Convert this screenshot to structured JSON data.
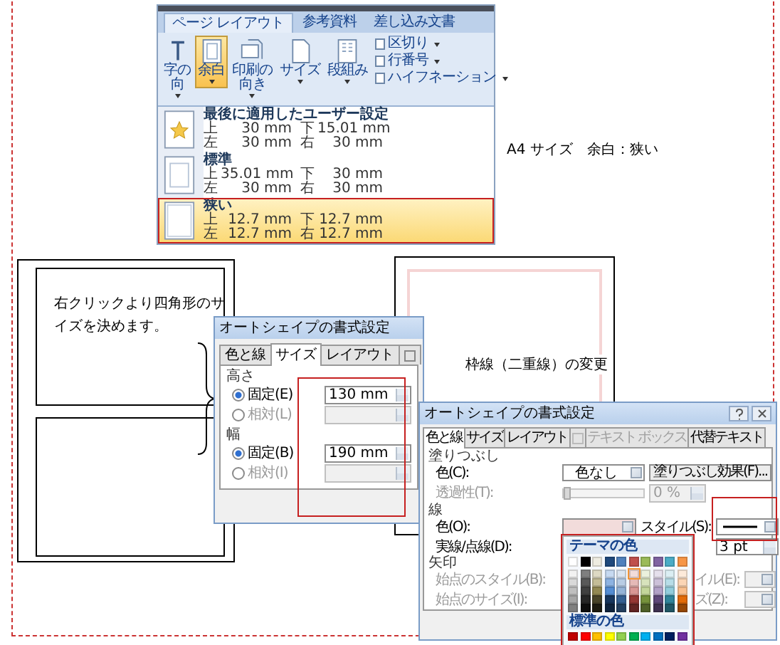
{
  "ribbon": {
    "tabs": [
      {
        "label": "ページ レイアウト",
        "selected": true
      },
      {
        "label": "参考資料",
        "selected": false
      },
      {
        "label": "差し込み文書",
        "selected": false
      }
    ],
    "buttons": [
      {
        "lines": [
          "字の",
          "向"
        ],
        "selected": false
      },
      {
        "lines": [
          "余白"
        ],
        "selected": true
      },
      {
        "lines": [
          "印刷の",
          "向き"
        ],
        "selected": false
      },
      {
        "lines": [
          "サイズ"
        ],
        "selected": false
      },
      {
        "lines": [
          "段組み"
        ],
        "selected": false
      }
    ],
    "small_buttons": [
      {
        "label": "区切り"
      },
      {
        "label": "行番号"
      },
      {
        "label": "ハイフネーション"
      }
    ],
    "margin_menu": [
      {
        "title": "最後に適用したユーザー設定",
        "kind": "star",
        "selected": false,
        "values": [
          {
            "label": "上",
            "value": "30 mm"
          },
          {
            "label": "下",
            "value": "15.01 mm"
          },
          {
            "label": "左",
            "value": "30 mm"
          },
          {
            "label": "右",
            "value": "30 mm"
          }
        ]
      },
      {
        "title": "標準",
        "kind": "normal",
        "selected": false,
        "values": [
          {
            "label": "上",
            "value": "35.01 mm"
          },
          {
            "label": "下",
            "value": "30 mm"
          },
          {
            "label": "左",
            "value": "30 mm"
          },
          {
            "label": "右",
            "value": "30 mm"
          }
        ]
      },
      {
        "title": "狭い",
        "kind": "narrow",
        "selected": true,
        "values": [
          {
            "label": "上",
            "value": "12.7 mm"
          },
          {
            "label": "下",
            "value": "12.7 mm"
          },
          {
            "label": "左",
            "value": "12.7 mm"
          },
          {
            "label": "右",
            "value": "12.7 mm"
          }
        ]
      }
    ]
  },
  "caption_margin": "A4 サイズ　余白：狭い",
  "note": "右クリックより四角形のサイズを決めます。",
  "caption_border": "枠線（二重線）の変更",
  "size_dialog": {
    "title": "オートシェイプの書式設定",
    "tabs": [
      {
        "kind": "text",
        "label": "色と線",
        "selected": false
      },
      {
        "kind": "text",
        "label": "サイズ",
        "selected": true
      },
      {
        "kind": "text",
        "label": "レイアウト",
        "selected": false
      },
      {
        "kind": "icon",
        "selected": false
      }
    ],
    "groups": [
      {
        "heading": "高さ",
        "options": [
          {
            "label": "固定(E)",
            "selected": true,
            "disabled": false,
            "value": "130 mm"
          },
          {
            "label": "相対(L)",
            "selected": false,
            "disabled": true
          }
        ]
      },
      {
        "heading": "幅",
        "options": [
          {
            "label": "固定(B)",
            "selected": true,
            "disabled": false,
            "value": "190 mm"
          },
          {
            "label": "相対(I)",
            "selected": false,
            "disabled": true
          }
        ]
      }
    ]
  },
  "format_dialog": {
    "title": "オートシェイプの書式設定",
    "tabs": [
      {
        "kind": "text",
        "label": "色と線",
        "selected": true,
        "disabled": false
      },
      {
        "kind": "text",
        "label": "サイズ",
        "selected": false,
        "disabled": false
      },
      {
        "kind": "text",
        "label": "レイアウト",
        "selected": false,
        "disabled": false
      },
      {
        "kind": "icon",
        "selected": false,
        "disabled": true
      },
      {
        "kind": "text",
        "label": "テキスト ボックス",
        "selected": false,
        "disabled": true
      },
      {
        "kind": "text",
        "label": "代替テキスト",
        "selected": false,
        "disabled": false
      }
    ],
    "fill": {
      "heading": "塗りつぶし",
      "color_label": "色(C):",
      "color_value": "色なし",
      "effects_button": "塗りつぶし効果(F)..."
    },
    "transparency": {
      "label": "透過性(T):",
      "value": "0 %",
      "level": 0
    },
    "line": {
      "heading": "線",
      "color_label": "色(O):",
      "style_label": "スタイル(S):",
      "dash_label": "実線/点線(D):",
      "weight": "3 pt"
    },
    "arrows": {
      "heading": "矢印",
      "begin_style": "始点のスタイル(B):",
      "begin_size": "始点のサイズ(I):",
      "end_style": "イル(E):",
      "end_size": "ズ(Z):"
    },
    "palette": {
      "theme_heading": "テーマの色",
      "standard_heading": "標準の色",
      "columns": [
        [
          {
            "color": "#ffffff",
            "selected": false
          },
          {
            "color": "#f2f2f2",
            "selected": false
          },
          {
            "color": "#d9d9d9",
            "selected": false
          },
          {
            "color": "#bfbfbf",
            "selected": false
          },
          {
            "color": "#a6a6a6",
            "selected": false
          },
          {
            "color": "#808080",
            "selected": false
          }
        ],
        [
          {
            "color": "#000000",
            "selected": false
          },
          {
            "color": "#7f7f7f",
            "selected": false
          },
          {
            "color": "#595959",
            "selected": false
          },
          {
            "color": "#404040",
            "selected": false
          },
          {
            "color": "#262626",
            "selected": false
          },
          {
            "color": "#0d0d0d",
            "selected": false
          }
        ],
        [
          {
            "color": "#eeece1",
            "selected": false
          },
          {
            "color": "#ddd9c3",
            "selected": false
          },
          {
            "color": "#c4bd97",
            "selected": false
          },
          {
            "color": "#938953",
            "selected": false
          },
          {
            "color": "#494429",
            "selected": false
          },
          {
            "color": "#1d1b10",
            "selected": false
          }
        ],
        [
          {
            "color": "#1f497d",
            "selected": false
          },
          {
            "color": "#c6d9f0",
            "selected": false
          },
          {
            "color": "#8db3e2",
            "selected": false
          },
          {
            "color": "#548dd4",
            "selected": false
          },
          {
            "color": "#17365d",
            "selected": false
          },
          {
            "color": "#0f243e",
            "selected": false
          }
        ],
        [
          {
            "color": "#4f81bd",
            "selected": false
          },
          {
            "color": "#dbe5f1",
            "selected": false
          },
          {
            "color": "#b8cce4",
            "selected": false
          },
          {
            "color": "#95b3d7",
            "selected": false
          },
          {
            "color": "#366092",
            "selected": false
          },
          {
            "color": "#244061",
            "selected": false
          }
        ],
        [
          {
            "color": "#c0504d",
            "selected": false
          },
          {
            "color": "#f2dcdb",
            "selected": true
          },
          {
            "color": "#e5b9b7",
            "selected": false
          },
          {
            "color": "#d99694",
            "selected": false
          },
          {
            "color": "#953734",
            "selected": false
          },
          {
            "color": "#632423",
            "selected": false
          }
        ],
        [
          {
            "color": "#9bbb59",
            "selected": false
          },
          {
            "color": "#ebf1dd",
            "selected": false
          },
          {
            "color": "#d7e3bc",
            "selected": false
          },
          {
            "color": "#c3d69b",
            "selected": false
          },
          {
            "color": "#76923c",
            "selected": false
          },
          {
            "color": "#4f6128",
            "selected": false
          }
        ],
        [
          {
            "color": "#8064a2",
            "selected": false
          },
          {
            "color": "#e5e0ec",
            "selected": false
          },
          {
            "color": "#ccc1d9",
            "selected": false
          },
          {
            "color": "#b2a2c7",
            "selected": false
          },
          {
            "color": "#5f497a",
            "selected": false
          },
          {
            "color": "#3f3151",
            "selected": false
          }
        ],
        [
          {
            "color": "#4bacc6",
            "selected": false
          },
          {
            "color": "#dbeef3",
            "selected": false
          },
          {
            "color": "#b7dde8",
            "selected": false
          },
          {
            "color": "#92cddc",
            "selected": false
          },
          {
            "color": "#31859b",
            "selected": false
          },
          {
            "color": "#205867",
            "selected": false
          }
        ],
        [
          {
            "color": "#f79646",
            "selected": false
          },
          {
            "color": "#fdeada",
            "selected": false
          },
          {
            "color": "#fbd5b5",
            "selected": false
          },
          {
            "color": "#fac08f",
            "selected": false
          },
          {
            "color": "#e36c09",
            "selected": false
          },
          {
            "color": "#974806",
            "selected": false
          }
        ]
      ],
      "standard": [
        {
          "color": "#c00000",
          "selected": false
        },
        {
          "color": "#ff0000",
          "selected": false
        },
        {
          "color": "#ffc000",
          "selected": false
        },
        {
          "color": "#ffff00",
          "selected": false
        },
        {
          "color": "#92d050",
          "selected": false
        },
        {
          "color": "#00b050",
          "selected": false
        },
        {
          "color": "#00b0f0",
          "selected": false
        },
        {
          "color": "#0070c0",
          "selected": false
        },
        {
          "color": "#002060",
          "selected": false
        },
        {
          "color": "#7030a0",
          "selected": false
        }
      ]
    }
  }
}
